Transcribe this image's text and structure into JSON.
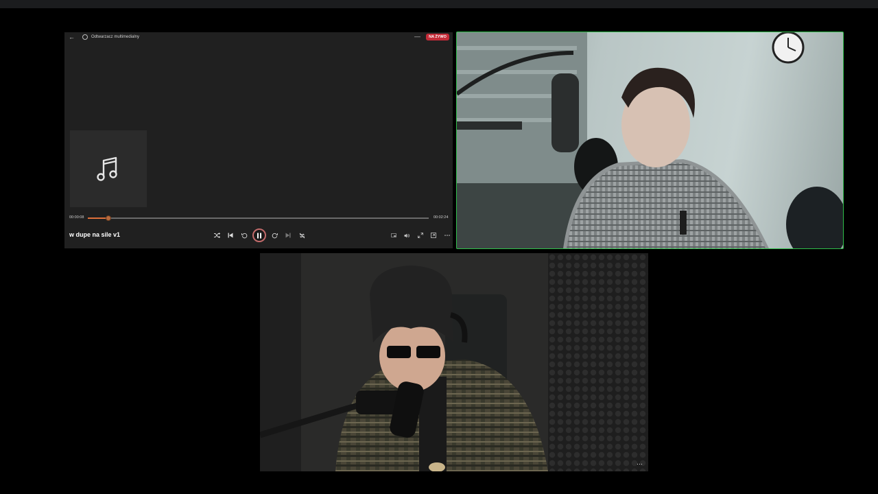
{
  "player": {
    "back_icon": "back-arrow-icon",
    "app_icon": "media-player-icon",
    "title": "Odtwarzacz multimedialny",
    "minimize_icon": "minimize-icon",
    "live_badge": "NA ŻYWO",
    "album_art_icon": "music-note-icon",
    "current_time": "00:00:08",
    "total_time": "00:02:24",
    "progress": 0.06,
    "song_title": "w dupe na sile v1",
    "controls": [
      "shuffle-icon",
      "previous-icon",
      "rewind-10-icon",
      "pause-icon",
      "forward-30-icon",
      "next-icon",
      "repeat-off-icon"
    ],
    "right_controls": [
      "miniplayer-icon",
      "volume-icon",
      "fullscreen-icon",
      "cast-icon",
      "more-icon"
    ],
    "accent_color": "#e0703a",
    "live_color": "#c42b38"
  },
  "videos": {
    "top": {
      "active_speaker": true,
      "border_color": "#2fbf4a"
    },
    "bottom": {
      "more_label": "···"
    }
  }
}
